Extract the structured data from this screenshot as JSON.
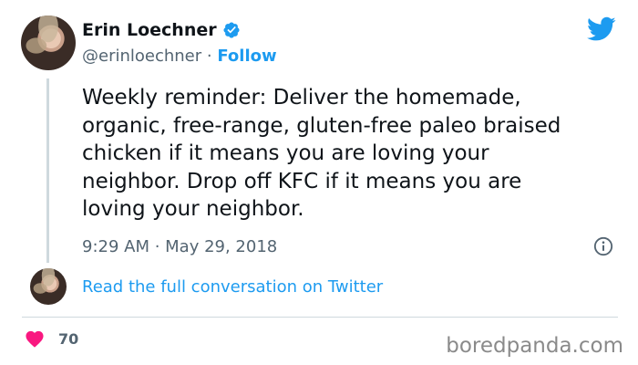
{
  "author": {
    "name": "Erin Loechner",
    "handle": "@erinloechner",
    "separator": " · ",
    "follow_label": "Follow"
  },
  "tweet": {
    "text": "Weekly reminder: Deliver the homemade,\norganic, free-range, gluten-free paleo braised\nchicken if it means you are loving your\nneighbor. Drop off KFC if it means you are\nloving your neighbor.",
    "timestamp": "9:29 AM · May 29, 2018"
  },
  "conversation_link": "Read the full conversation on Twitter",
  "likes": {
    "count": "70"
  },
  "watermark": "boredpanda.com",
  "colors": {
    "twitter_blue": "#1d9bf0",
    "heart_pink": "#f91880",
    "secondary_text": "#536471"
  },
  "icons": [
    "verified-badge-icon",
    "twitter-bird-icon",
    "info-icon",
    "heart-icon"
  ]
}
